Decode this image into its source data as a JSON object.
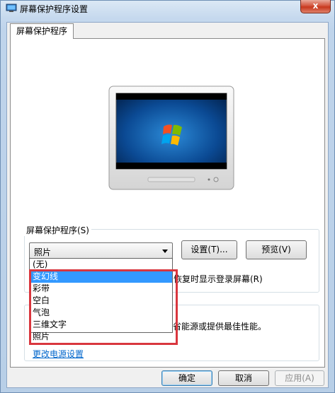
{
  "window": {
    "title": "屏幕保护程序设置",
    "close_label": "x"
  },
  "tab": {
    "label": "屏幕保护程序"
  },
  "screensaver": {
    "group_label": "屏幕保护程序(S)",
    "selected": "照片",
    "settings_button": "设置(T)...",
    "preview_button": "预览(V)",
    "options": [
      "(无)",
      "变幻线",
      "彩带",
      "空白",
      "气泡",
      "三维文字",
      "照片"
    ],
    "highlighted_index": 1,
    "resume_text_partial": "恢复时显示登录屏幕(R)"
  },
  "power": {
    "text_partial": "省能源或提供最佳性能。",
    "link": "更改电源设置"
  },
  "footer": {
    "ok": "确定",
    "cancel": "取消",
    "apply": "应用(A)"
  },
  "colors": {
    "selection": "#3399ff",
    "annotation": "#d9363e",
    "link": "#0066cc"
  }
}
